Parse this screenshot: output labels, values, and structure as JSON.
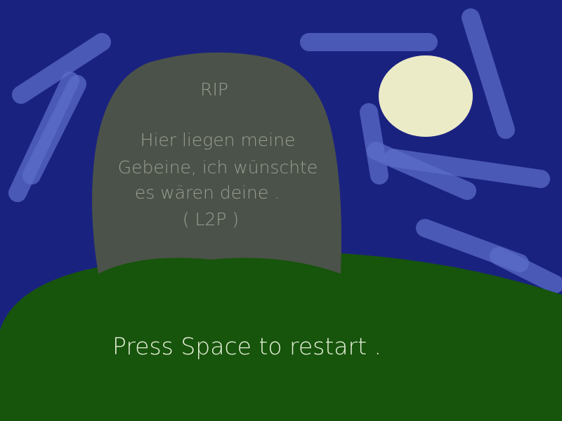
{
  "tombstone": {
    "title": "RIP",
    "lines": [
      "Hier liegen meine",
      "Gebeine, ich wünschte",
      "es wären deine .",
      "( L2P )"
    ]
  },
  "prompt": "Press Space to restart .",
  "colors": {
    "sky": "#1a2280",
    "grass": "#17540c",
    "stone": "#4b5249",
    "moon": "#ecebc8",
    "streak": "#5b6cc8"
  }
}
